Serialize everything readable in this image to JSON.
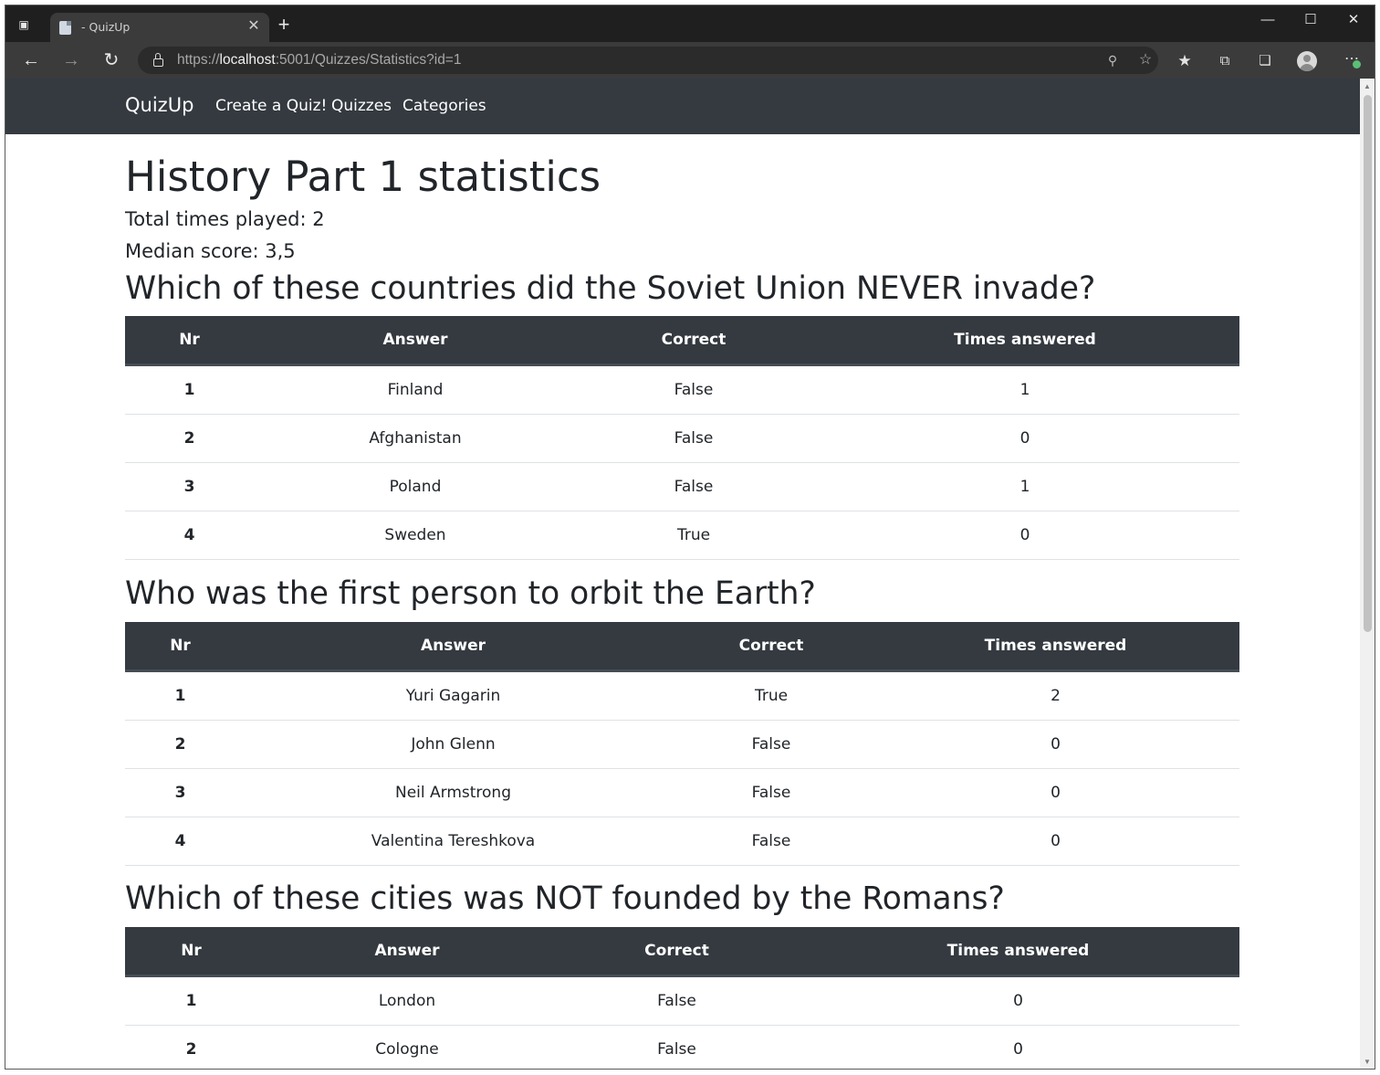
{
  "browser": {
    "tab_title": "- QuizUp",
    "url_scheme": "https://",
    "url_host": "localhost",
    "url_rest": ":5001/Quizzes/Statistics?id=1"
  },
  "site": {
    "brand": "QuizUp",
    "nav": [
      "Create a Quiz!",
      "Quizzes",
      "Categories"
    ]
  },
  "page": {
    "title": "History Part 1 statistics",
    "total_played": "Total times played: 2",
    "median_score": "Median score: 3,5"
  },
  "table_headers": [
    "Nr",
    "Answer",
    "Correct",
    "Times answered"
  ],
  "questions": [
    {
      "title": "Which of these countries did the Soviet Union NEVER invade?",
      "rows": [
        [
          "1",
          "Finland",
          "False",
          "1"
        ],
        [
          "2",
          "Afghanistan",
          "False",
          "0"
        ],
        [
          "3",
          "Poland",
          "False",
          "1"
        ],
        [
          "4",
          "Sweden",
          "True",
          "0"
        ]
      ]
    },
    {
      "title": "Who was the first person to orbit the Earth?",
      "rows": [
        [
          "1",
          "Yuri Gagarin",
          "True",
          "2"
        ],
        [
          "2",
          "John Glenn",
          "False",
          "0"
        ],
        [
          "3",
          "Neil Armstrong",
          "False",
          "0"
        ],
        [
          "4",
          "Valentina Tereshkova",
          "False",
          "0"
        ]
      ]
    },
    {
      "title": "Which of these cities was NOT founded by the Romans?",
      "rows": [
        [
          "1",
          "London",
          "False",
          "0"
        ],
        [
          "2",
          "Cologne",
          "False",
          "0"
        ]
      ]
    }
  ],
  "colors": {
    "navbar": "#343a40",
    "table_head": "#343a40",
    "text": "#212529",
    "row_divider": "#dee2e6"
  }
}
